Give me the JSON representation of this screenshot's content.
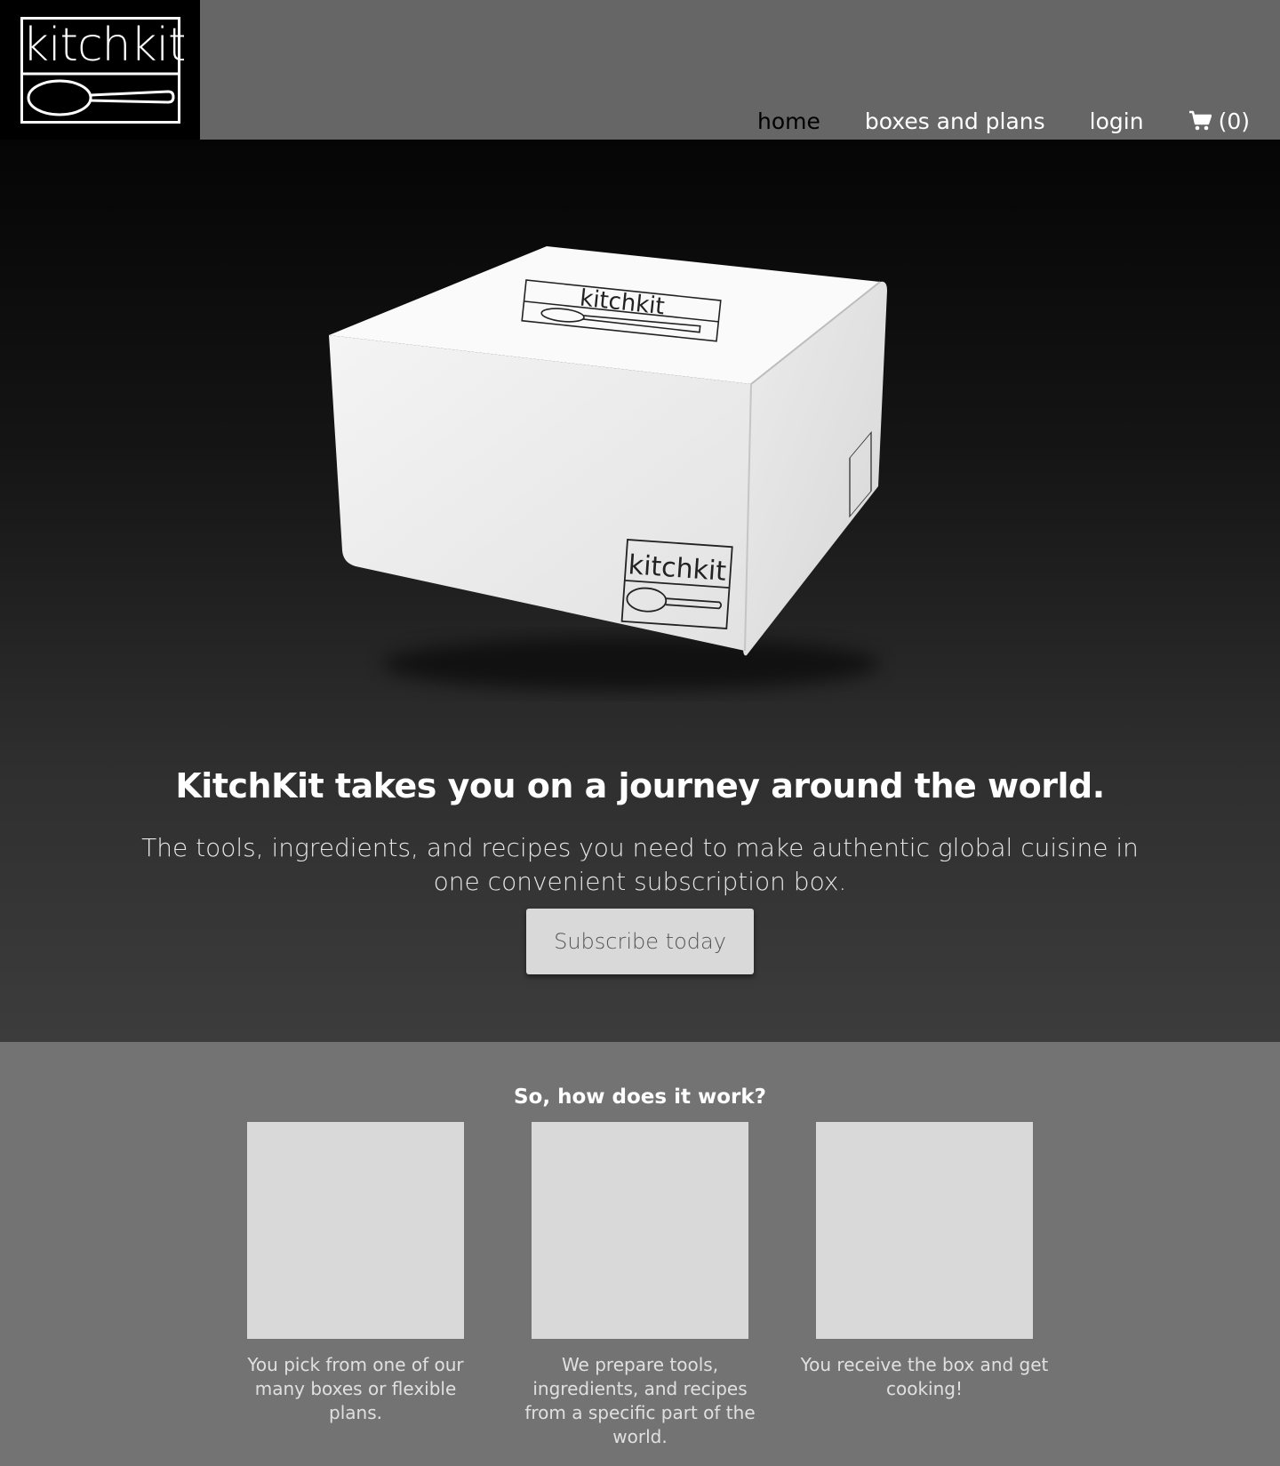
{
  "header": {
    "logo_text": "kitchkit",
    "nav": {
      "home": "home",
      "boxes_plans": "boxes and plans",
      "login": "login",
      "cart_count": "(0)"
    }
  },
  "hero": {
    "box_logo_text": "kitchkit",
    "headline": "KitchKit takes you on a journey around the world.",
    "subheadline": "The tools, ingredients, and recipes you need to make authentic global cuisine in one convenient subscription box.",
    "cta_label": "Subscribe today"
  },
  "how_it_works": {
    "title": "So, how does it work?",
    "steps": [
      {
        "caption": "You pick from one of our many boxes or flexible plans."
      },
      {
        "caption": "We prepare tools, ingredients, and recipes from a specific part of the world."
      },
      {
        "caption": "You receive the box and get cooking!"
      }
    ]
  },
  "colors": {
    "topbar": "#666666",
    "logo_bg": "#000000",
    "how_bg": "#737373",
    "placeholder": "#d9d9d9"
  }
}
